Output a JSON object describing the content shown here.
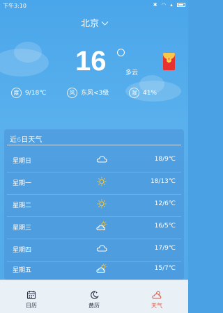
{
  "status_bar": {
    "time": "下午3:10"
  },
  "header": {
    "city": "北京"
  },
  "current": {
    "temperature": "16",
    "condition": "多云",
    "temp_range": "9/18℃",
    "wind": "东风<3级",
    "humidity": "41%",
    "labels": {
      "temp_range": "度",
      "wind": "风",
      "humidity": "湿"
    }
  },
  "forecast": {
    "title_prefix": "近",
    "title_num": "6",
    "title_suffix": "日天气",
    "days": [
      {
        "day": "星期日",
        "icon": "cloud-outline-icon",
        "range": "18/9℃"
      },
      {
        "day": "星期一",
        "icon": "sun-icon",
        "range": "18/13℃"
      },
      {
        "day": "星期二",
        "icon": "sun-icon",
        "range": "12/6℃"
      },
      {
        "day": "星期三",
        "icon": "partly-cloudy-icon",
        "range": "16/5℃"
      },
      {
        "day": "星期四",
        "icon": "cloud-icon",
        "range": "17/9℃"
      },
      {
        "day": "星期五",
        "icon": "partly-cloudy-icon",
        "range": "15/7℃"
      }
    ]
  },
  "tabs": [
    {
      "label": "日历",
      "icon": "calendar-icon",
      "active": false
    },
    {
      "label": "黄历",
      "icon": "moon-star-icon",
      "active": false
    },
    {
      "label": "天气",
      "icon": "weather-cloud-icon",
      "active": true
    }
  ],
  "colors": {
    "active_tab": "#d45b4b",
    "red_packet": "#e8322f",
    "sun": "#f3c53b"
  }
}
